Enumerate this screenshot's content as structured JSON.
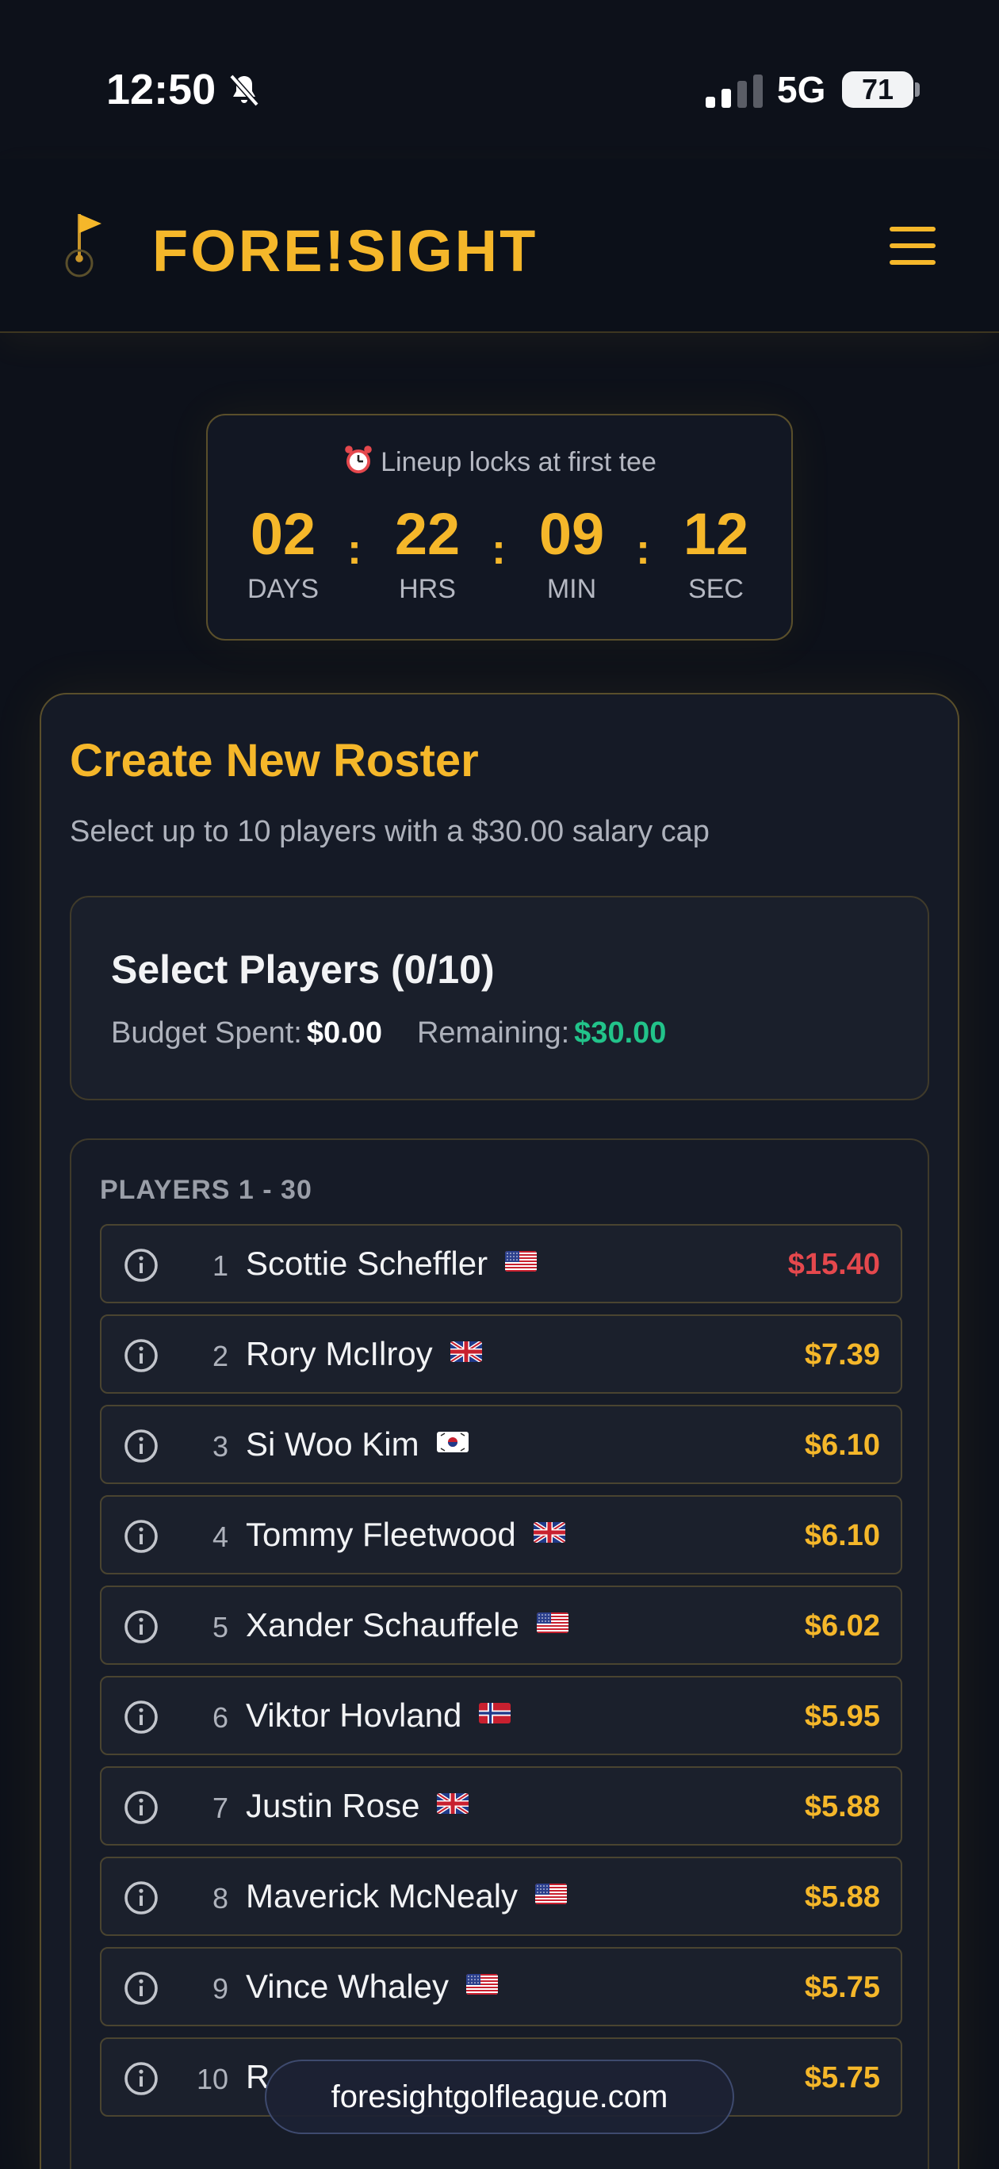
{
  "status_bar": {
    "time": "12:50",
    "network": "5G",
    "battery": "71"
  },
  "header": {
    "logo_text": "FORE!SIGHT"
  },
  "countdown": {
    "label": "Lineup locks at first tee",
    "units": [
      {
        "value": "02",
        "caption": "DAYS"
      },
      {
        "value": "22",
        "caption": "HRS"
      },
      {
        "value": "09",
        "caption": "MIN"
      },
      {
        "value": "12",
        "caption": "SEC"
      }
    ],
    "separator": ":"
  },
  "roster": {
    "title": "Create New Roster",
    "subtitle": "Select up to 10 players with a $30.00 salary cap",
    "select_title": "Select Players (0/10)",
    "budget_label": "Budget Spent:",
    "budget_value": "$0.00",
    "remaining_label": "Remaining:",
    "remaining_value": "$30.00",
    "players_header": "PLAYERS 1 - 30",
    "players": [
      {
        "rank": "1",
        "name": "Scottie Scheffler",
        "flag": "us",
        "price": "$15.40"
      },
      {
        "rank": "2",
        "name": "Rory McIlroy",
        "flag": "gb",
        "price": "$7.39"
      },
      {
        "rank": "3",
        "name": "Si Woo Kim",
        "flag": "kr",
        "price": "$6.10"
      },
      {
        "rank": "4",
        "name": "Tommy Fleetwood",
        "flag": "gb",
        "price": "$6.10"
      },
      {
        "rank": "5",
        "name": "Xander Schauffele",
        "flag": "us",
        "price": "$6.02"
      },
      {
        "rank": "6",
        "name": "Viktor Hovland",
        "flag": "no",
        "price": "$5.95"
      },
      {
        "rank": "7",
        "name": "Justin Rose",
        "flag": "gb",
        "price": "$5.88"
      },
      {
        "rank": "8",
        "name": "Maverick McNealy",
        "flag": "us",
        "price": "$5.88"
      },
      {
        "rank": "9",
        "name": "Vince Whaley",
        "flag": "us",
        "price": "$5.75"
      },
      {
        "rank": "10",
        "name": "R",
        "flag": "",
        "price": "$5.75"
      }
    ]
  },
  "url_bar": {
    "url": "foresightgolfleague.com"
  },
  "colors": {
    "accent": "#f5b72a",
    "price_high": "#e5484d",
    "remaining": "#22c38a",
    "background": "#0d111a"
  }
}
